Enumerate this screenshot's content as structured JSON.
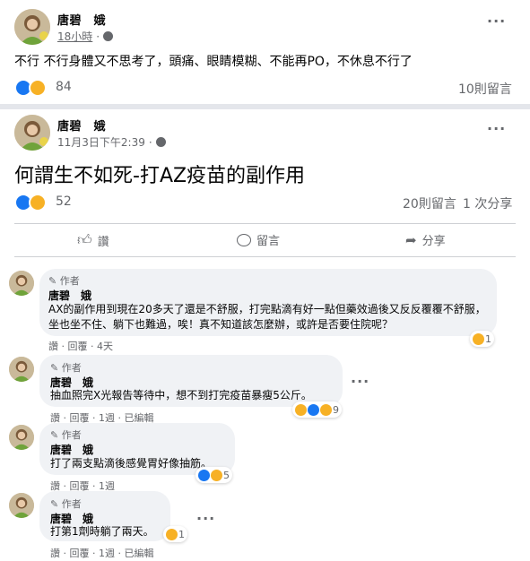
{
  "post1": {
    "author": "唐碧　娥",
    "time": "18小時",
    "text": "不行 不行身體又不思考了，頭痛、眼睛模糊、不能再PO，不休息不行了",
    "reaction_count": "84",
    "comments": "10則留言"
  },
  "post2": {
    "author": "唐碧　娥",
    "time": "11月3日下午2:39",
    "text": "何謂生不如死-打AZ疫苗的副作用",
    "reaction_count": "52",
    "comments": "20則留言",
    "shares": "1 次分享"
  },
  "actions": {
    "like": "讚",
    "comment": "留言",
    "share": "分享"
  },
  "comments": [
    {
      "tag": "作者",
      "name": "唐碧　娥",
      "text": "AX的副作用到現在20多天了還是不舒服，打完點滴有好一點但藥效過後又反反覆覆不舒服，坐也坐不住、躺下也難過，唉！真不知道該怎麼辦，或許是否要住院呢？",
      "actions": "讚 · 回覆 · 4天",
      "reactions": "1"
    },
    {
      "tag": "作者",
      "name": "唐碧　娥",
      "text": "抽血照完X光報告等待中，想不到打完疫苗暴瘦5公斤。",
      "actions": "讚 · 回覆 · 1週 · 已編輯",
      "reactions": "9"
    },
    {
      "tag": "作者",
      "name": "唐碧　娥",
      "text": "打了兩支點滴後感覺胃好像抽筋。",
      "actions": "讚 · 回覆 · 1週",
      "reactions": "5"
    },
    {
      "tag": "作者",
      "name": "唐碧　娥",
      "text": "打第1劑時躺了兩天。",
      "actions": "讚 · 回覆 · 1週 · 已編輯",
      "reactions": "1"
    }
  ],
  "more_icon": "···",
  "colors": {
    "like": "#1877f2",
    "haha": "#f7b125",
    "bubble": "#f0f2f5"
  }
}
